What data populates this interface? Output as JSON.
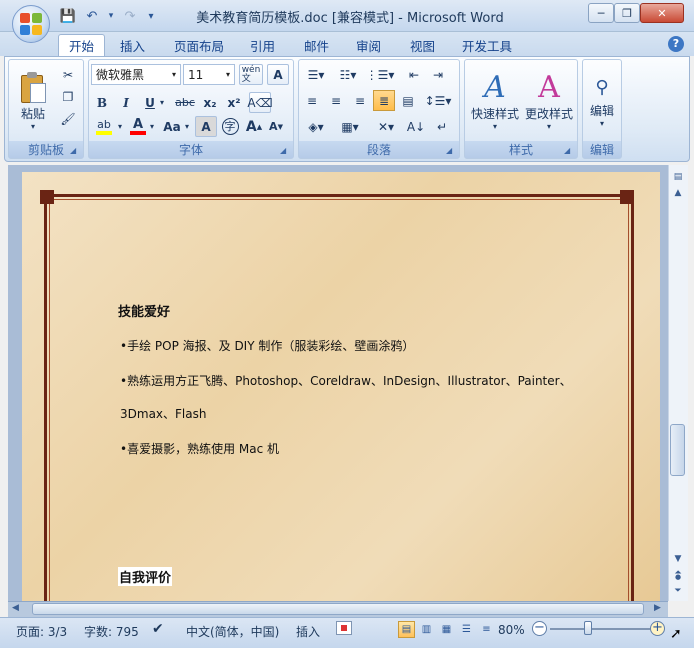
{
  "window": {
    "title": "美术教育简历模板.doc [兼容模式] - Microsoft Word",
    "minimize": "─",
    "restore": "❐",
    "close": "✕"
  },
  "qat": {
    "save": "💾",
    "undo": "↶",
    "redo": "↷",
    "customize": "▾"
  },
  "tabs": [
    "开始",
    "插入",
    "页面布局",
    "引用",
    "邮件",
    "审阅",
    "视图",
    "开发工具"
  ],
  "help": "?",
  "ribbon": {
    "clipboard": {
      "label": "剪贴板",
      "paste": "粘贴"
    },
    "font": {
      "label": "字体",
      "font_name": "微软雅黑",
      "font_size": "11",
      "bold": "B",
      "italic": "I",
      "underline": "U",
      "strike": "abc",
      "subscript": "x₂",
      "superscript": "x²",
      "change_case": "Aa",
      "grow": "A",
      "shrink": "A",
      "highlight_color": "#ffff00",
      "font_color": "#ff0000"
    },
    "paragraph": {
      "label": "段落"
    },
    "styles": {
      "label": "样式",
      "quick_styles": "快速样式",
      "change_styles": "更改样式"
    },
    "editing": {
      "label": "编辑",
      "editing": "编辑"
    }
  },
  "document": {
    "section1_title": "技能爱好",
    "bullets": [
      "•手绘 POP 海报、及 DIY 制作（服装彩绘、壁画涂鸦）",
      "•熟练运用方正飞腾、Photoshop、Coreldraw、InDesign、Illustrator、Painter、",
      "3Dmax、Flash",
      "•喜爱摄影，熟练使用 Mac 机"
    ],
    "section2_title": "自我评价"
  },
  "statusbar": {
    "page": "页面: 3/3",
    "words": "字数: 795",
    "language": "中文(简体，中国)",
    "mode": "插入",
    "zoom": "80%"
  },
  "colors": {
    "accent": "#15428b",
    "frame": "#6a2414"
  }
}
